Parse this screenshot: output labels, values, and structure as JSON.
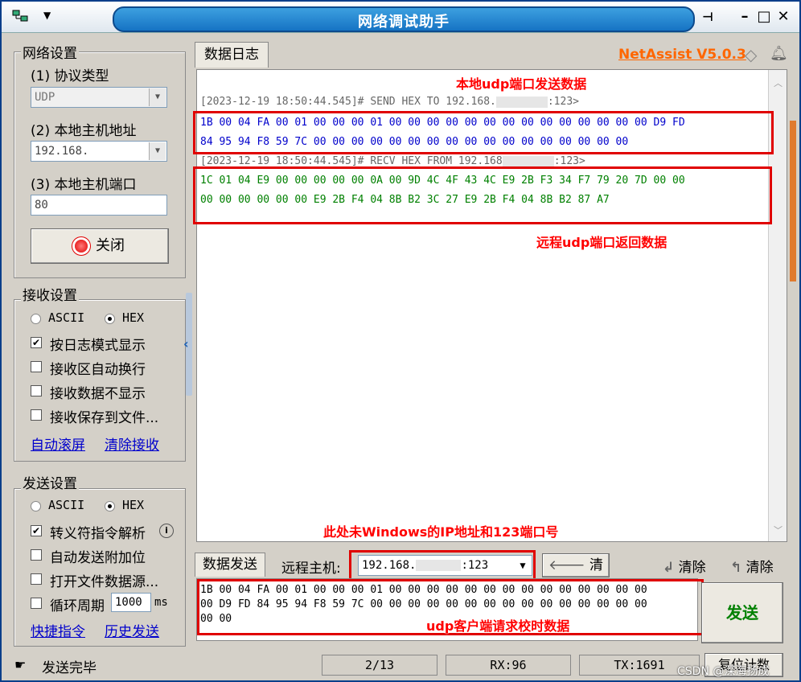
{
  "window": {
    "title": "网络调试助手",
    "brand": "NetAssist V5.0.3",
    "pin_glyph": "⊣",
    "minimize_glyph": "–",
    "maximize_glyph": "□",
    "close_glyph": "✕"
  },
  "network": {
    "legend": "网络设置",
    "protocol_label": "(1) 协议类型",
    "protocol_value": "UDP",
    "host_label": "(2) 本地主机地址",
    "host_value": "192.168.",
    "port_label": "(3) 本地主机端口",
    "port_value": "80",
    "toggle_label": "关闭"
  },
  "receive": {
    "legend": "接收设置",
    "ascii_label": "ASCII",
    "hex_label": "HEX",
    "options": [
      "按日志模式显示",
      "接收区自动换行",
      "接收数据不显示",
      "接收保存到文件..."
    ],
    "options_checked": [
      true,
      false,
      false,
      false
    ],
    "auto_scroll": "自动滚屏",
    "clear_recv": "清除接收"
  },
  "send_settings": {
    "legend": "发送设置",
    "ascii_label": "ASCII",
    "hex_label": "HEX",
    "options": [
      "转义符指令解析",
      "自动发送附加位",
      "打开文件数据源...",
      "循环周期"
    ],
    "options_checked": [
      true,
      false,
      false,
      false
    ],
    "period_value": "1000",
    "period_unit": "ms",
    "shortcut": "快捷指令",
    "history": "历史发送"
  },
  "log": {
    "tab": "数据日志",
    "send_header": "[2023-12-19 18:50:44.545]# SEND HEX TO 192.168.",
    "send_port": ":123>",
    "send_line1": "1B 00 04 FA 00 01 00 00 00 01 00 00 00 00 00 00 00 00 00 00 00 00 00 00 D9 FD",
    "send_line2": "84 95 94 F8 59 7C 00 00 00 00 00 00 00 00 00 00 00 00 00 00 00 00 00",
    "recv_header": "[2023-12-19 18:50:44.545]# RECV HEX FROM 192.168",
    "recv_port": ":123>",
    "recv_line1": "1C 01 04 E9 00 00 00 00 00 0A 00 9D 4C 4F 43 4C E9 2B F3 34 F7 79 20 7D 00 00",
    "recv_line2": "00 00 00 00 00 00 E9 2B F4 04 8B B2 3C 27 E9 2B F4 04 8B B2 87 A7"
  },
  "annotations": {
    "local_send": "本地udp端口发送数据",
    "remote_return": "远程udp端口返回数据",
    "windows_ip": "此处未Windows的IP地址和123端口号",
    "client_request": "udp客户端请求校时数据"
  },
  "send_area": {
    "tab": "数据发送",
    "remote_label": "远程主机:",
    "remote_value": "192.168.",
    "remote_port": ":123",
    "clear_btn": "清除",
    "clear2": "清除",
    "clear3": "清除",
    "content_line1": "1B 00 04 FA 00 01 00 00 00 01 00 00 00 00 00 00 00 00 00 00 00 00 00 00",
    "content_line2": "00 D9 FD 84 95 94 F8 59 7C 00 00 00 00 00 00 00 00 00 00 00 00 00 00 00",
    "content_line3": "00 00",
    "send_btn": "发送",
    "reset_btn": "复位计数"
  },
  "statusbar": {
    "message": "发送完毕",
    "counter": "2/13",
    "rx": "RX:96",
    "tx": "TX:1691",
    "watermark": "CSDN @深海扬成"
  },
  "colors": {
    "title_blue": "#1673c4",
    "brand_orange": "#ff6600",
    "send_text": "#0000cc",
    "recv_text": "#008000",
    "annotation_red": "#ff0000",
    "send_btn_green": "#008000"
  }
}
